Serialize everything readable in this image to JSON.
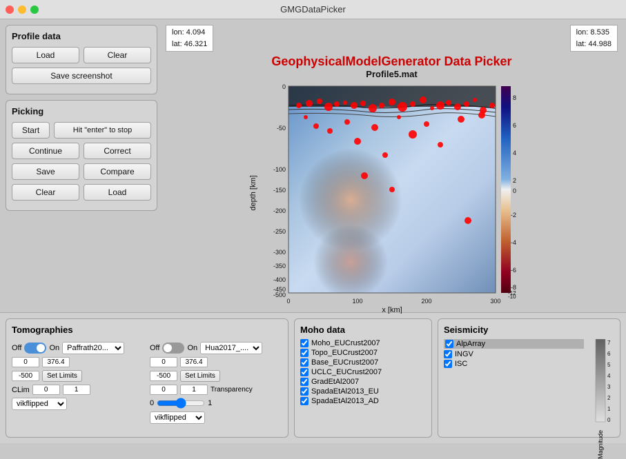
{
  "titlebar": {
    "title": "GMGDataPicker"
  },
  "coords_left": {
    "lon": "lon: 4.094",
    "lat": "lat: 46.321"
  },
  "coords_right": {
    "lon": "lon: 8.535",
    "lat": "lat: 44.988"
  },
  "plot": {
    "title": "GeophysicalModelGenerator Data Picker",
    "profile": "Profile5.mat",
    "x_label": "x [km]",
    "y_label": "depth [km]"
  },
  "profile_data": {
    "title": "Profile data",
    "load_label": "Load",
    "clear_label": "Clear",
    "save_screenshot_label": "Save screenshot"
  },
  "picking": {
    "title": "Picking",
    "start_label": "Start",
    "hit_enter_label": "Hit \"enter\" to stop",
    "continue_label": "Continue",
    "correct_label": "Correct",
    "save_label": "Save",
    "compare_label": "Compare",
    "clear_label": "Clear",
    "load_label": "Load"
  },
  "tomographies": {
    "title": "Tomographies",
    "col1": {
      "off_label": "Off",
      "on_label": "On",
      "dropdown_value": "Paffrath20...",
      "val1": "0",
      "val2": "376.4",
      "val3": "-500",
      "set_limits_label": "Set Limits",
      "clim_label": "CLim",
      "clim_min": "0",
      "clim_max": "1",
      "colormap": "vikflipped"
    },
    "col2": {
      "off_label": "Off",
      "on_label": "On",
      "dropdown_value": "Hua2017_....",
      "val1": "0",
      "val2": "376.4",
      "val3": "-500",
      "set_limits_label": "Set Limits",
      "clim_min": "0",
      "clim_max": "1",
      "transparency_label": "Transparency",
      "slider_min": "0",
      "slider_val": "0.5",
      "slider_max": "1",
      "colormap": "vikflipped"
    }
  },
  "moho_data": {
    "title": "Moho data",
    "items": [
      {
        "label": "Moho_EUCrust2007",
        "checked": true
      },
      {
        "label": "Topo_EUCrust2007",
        "checked": true
      },
      {
        "label": "Base_EUCrust2007",
        "checked": true
      },
      {
        "label": "UCLC_EUCrust2007",
        "checked": true
      },
      {
        "label": "GradEtAl2007",
        "checked": true
      },
      {
        "label": "SpadaEtAl2013_EU",
        "checked": true
      },
      {
        "label": "SpadaEtAl2013_AD",
        "checked": true
      }
    ]
  },
  "seismicity": {
    "title": "Seismicity",
    "items": [
      {
        "label": "AlpArray",
        "checked": true,
        "highlight": true
      },
      {
        "label": "INGV",
        "checked": true,
        "highlight": false
      },
      {
        "label": "ISC",
        "checked": true,
        "highlight": false
      }
    ],
    "magnitude_label": "Magnitude",
    "scale_values": [
      "7",
      "6",
      "5",
      "4",
      "3",
      "2",
      "1",
      "0"
    ]
  }
}
